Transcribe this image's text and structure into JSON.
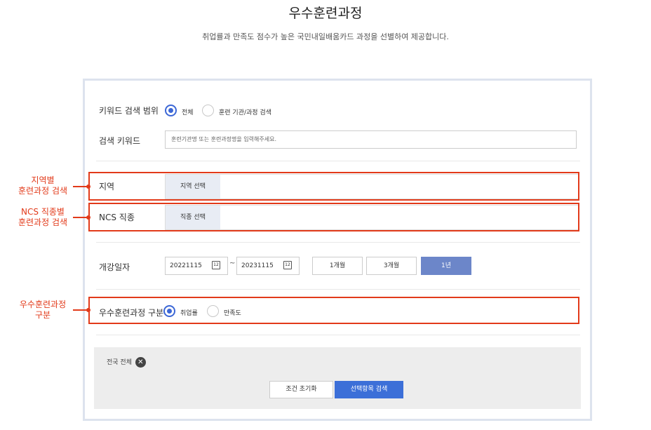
{
  "page": {
    "title": "우수훈련과정",
    "subtitle": "취업률과 만족도 점수가 높은 국민내일배움카드 과정을 선별하여 제공합니다."
  },
  "keyword_scope": {
    "label": "키워드 검색 범위",
    "options": [
      "전체",
      "훈련 기관/과정 검색"
    ],
    "selected": "전체"
  },
  "keyword": {
    "label": "검색 키워드",
    "placeholder": "훈련기관명 또는 훈련과정명을 입력해주세요."
  },
  "region": {
    "label": "지역",
    "button": "지역 선택"
  },
  "ncs": {
    "label": "NCS 직종",
    "button": "직종 선택"
  },
  "start_date": {
    "label": "개강일자",
    "from": "20221115",
    "separator": "~",
    "to": "20231115",
    "calendar_glyph": "12",
    "periods": [
      "1개월",
      "3개월",
      "1년"
    ],
    "selected_period": "1년"
  },
  "category": {
    "label": "우수훈련과정 구분",
    "options": [
      "취업률",
      "만족도"
    ],
    "selected": "취업률"
  },
  "filters": {
    "chip_label": "전국 전체",
    "chip_close": "✕",
    "reset_button": "조건 초기화",
    "search_button": "선택항목 검색"
  },
  "annotations": {
    "region": [
      "지역별",
      "훈련과정 검색"
    ],
    "ncs": [
      "NCS 직종별",
      "훈련과정 검색"
    ],
    "category": [
      "우수훈련과정",
      "구분"
    ]
  },
  "colors": {
    "accent": "#3c67d6",
    "annotation": "#e23a1a",
    "period_active": "#6c86c9"
  }
}
